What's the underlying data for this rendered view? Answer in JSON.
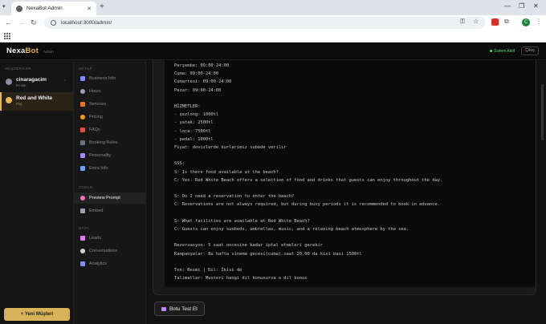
{
  "browser": {
    "tab_title": "NexaBot Admin",
    "url": "localhost:3000/admin/"
  },
  "app": {
    "logo_main": "Nexa",
    "logo_accent": "Bot",
    "logo_sub": "Admin",
    "status": "Sistem Aktif",
    "logout": "Çıkış"
  },
  "customers": {
    "heading": "MÜŞTERİLER",
    "items": [
      {
        "name": "cinaragacim",
        "sub": "Emlak",
        "color": "#8a8aa0"
      },
      {
        "name": "Red and White",
        "sub": "Plaj",
        "color": "#e8b84a"
      }
    ],
    "add_button": "+ Yeni Müşteri"
  },
  "nav": {
    "setup_heading": "SETUP",
    "setup_items": [
      {
        "label": "Business Info",
        "color": "#7c8cff"
      },
      {
        "label": "Hours",
        "color": "#9ca3af"
      },
      {
        "label": "Services",
        "color": "#f97316"
      },
      {
        "label": "Pricing",
        "color": "#f59e0b"
      },
      {
        "label": "FAQs",
        "color": "#ef4444"
      },
      {
        "label": "Booking Rules",
        "color": "#6b7280"
      },
      {
        "label": "Personality",
        "color": "#a78bfa"
      },
      {
        "label": "Extra Info",
        "color": "#60a5fa"
      }
    ],
    "tools_heading": "TOOLS",
    "tools_items": [
      {
        "label": "Preview Prompt",
        "color": "#f472b6"
      },
      {
        "label": "Embed",
        "color": "#9ca3af"
      }
    ],
    "data_heading": "DATA",
    "data_items": [
      {
        "label": "Leads",
        "color": "#e879f9"
      },
      {
        "label": "Conversations",
        "color": "#d1d5db"
      },
      {
        "label": "Analytics",
        "color": "#818cf8"
      }
    ]
  },
  "prompt_lines": [
    "Perşembe: 09:00-24:00",
    "Cuma: 09:00-24:00",
    "Cumartesi: 09:00-24:00",
    "Pazar: 09:00-24:00",
    "",
    "HİZMETLER:",
    "- şezlong: 1000tl",
    "- yatak: 2500tl",
    "- loca: 7500tl",
    "- pedal: 1000tl",
    "Fiyat: dovizlerde kurlarimiz subede verilir",
    "",
    "SSS:",
    "S: Is there food available at the beach?",
    "C: Yes. Red White Beach offers a selection of food and drinks that guests can enjoy throughout the day.",
    "",
    "S: Do I need a reservation to enter the beach?",
    "C: Reservations are not always required, but during busy periods it is recommended to book in advance.",
    "",
    "S: What facilities are available at Red White Beach?",
    "C: Guests can enjoy sunbeds, umbrellas, music, and a relaxing beach atmosphere by the sea.",
    "",
    "Rezervasyon: 5 saat oncesine kadar iptal etmeleri gerekir",
    "Kampanyalar: Bu hafta sinema gecesi(cuma).saat 20.00 da kisi basi 1500tl",
    "",
    "Ton: Resmi | Dil: İkisi de",
    "Talimatlar: Musteri hangi dil konusursa o dil konus"
  ],
  "test_button": "Botu Test Et"
}
